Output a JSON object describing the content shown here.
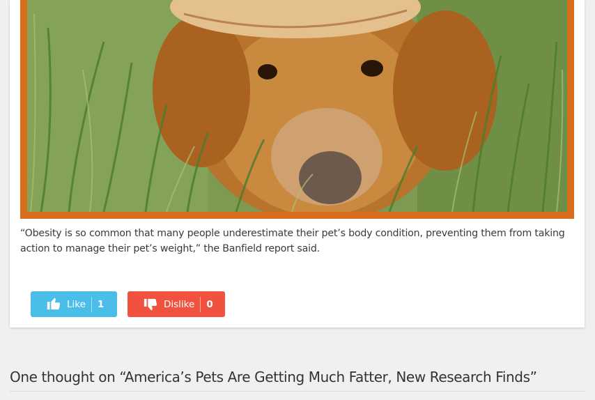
{
  "article": {
    "image_alt": "Golden retriever wearing a straw hat lying in tall grass",
    "quote": "“Obesity is so common that many people underestimate their pet’s body condition, preventing them from taking action to manage their pet’s weight,” the Banfield report said."
  },
  "votes": {
    "like_label": "Like",
    "like_count": "1",
    "dislike_label": "Dislike",
    "dislike_count": "0",
    "like_color": "#4bbde9",
    "dislike_color": "#f1513f"
  },
  "comments": {
    "title": "One thought on “America’s Pets Are Getting Much Fatter, New Research Finds”"
  },
  "colors": {
    "frame_border": "#d86d1c",
    "card_bg": "#ffffff",
    "page_bg": "#f0f0f0"
  },
  "icons": {
    "like": "thumbs-up-icon",
    "dislike": "thumbs-down-icon"
  }
}
